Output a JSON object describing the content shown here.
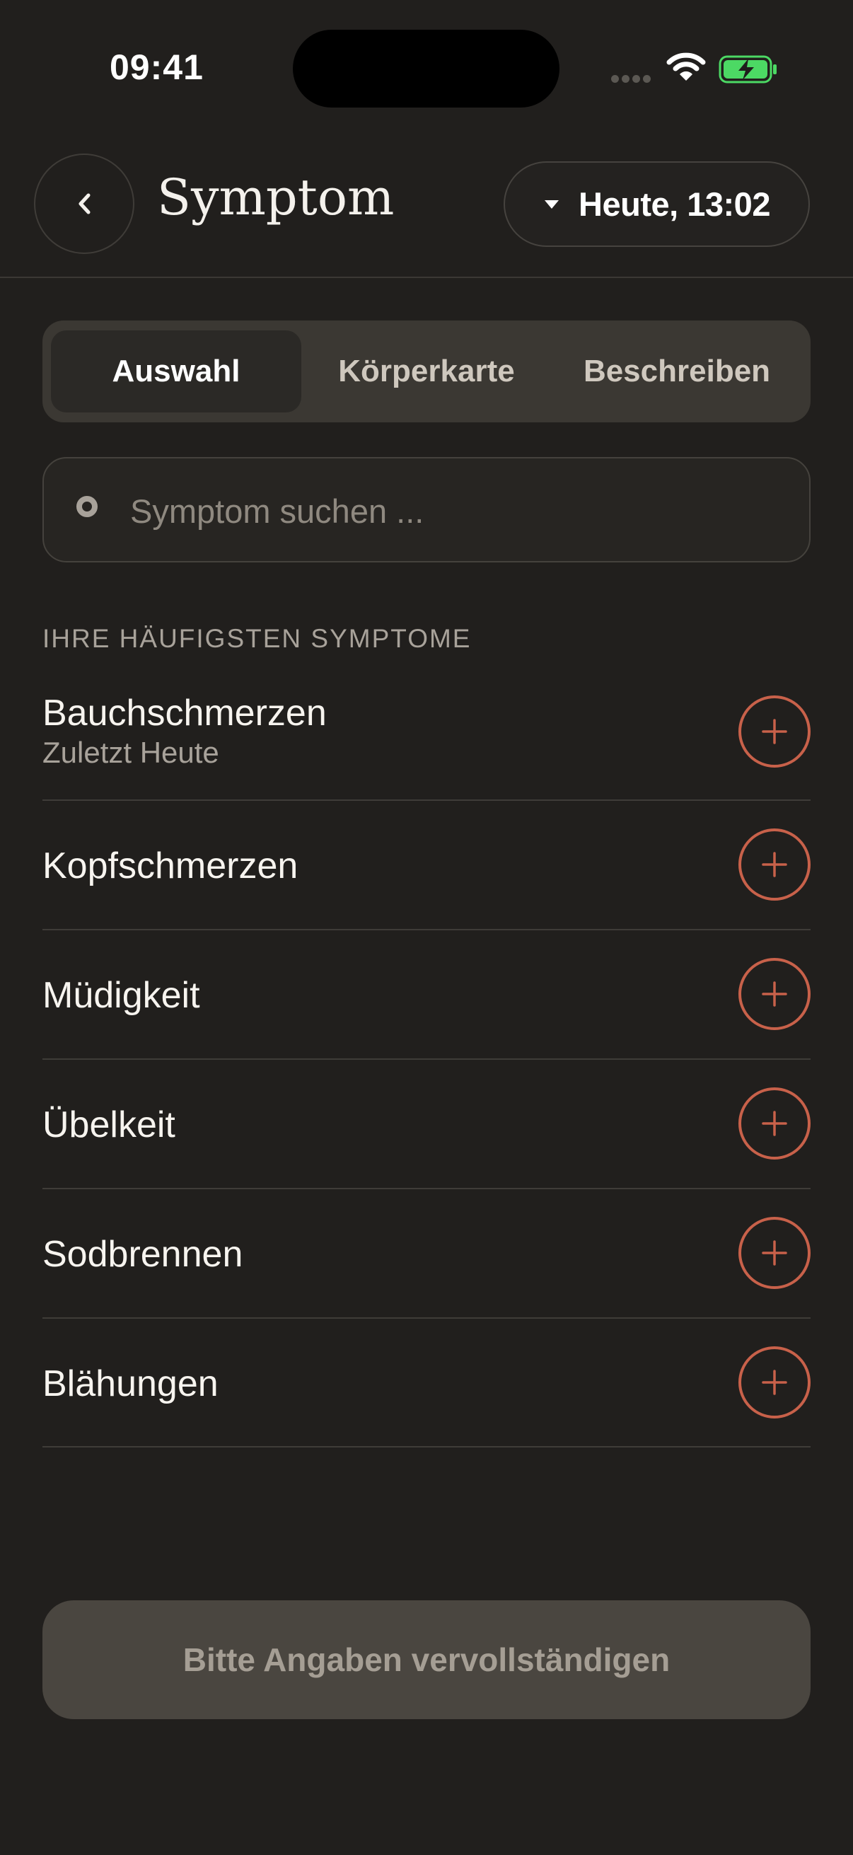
{
  "status_bar": {
    "time": "09:41",
    "icons": [
      "cellular-signal-icon",
      "wifi-icon",
      "battery-charging-icon"
    ],
    "battery_color": "#4cd964"
  },
  "header": {
    "title": "Symptom",
    "date_button_label": "Heute, 13:02",
    "icons": [
      "chevron-left-icon",
      "caret-down-icon"
    ]
  },
  "tabs": [
    {
      "label": "Auswahl",
      "active": true
    },
    {
      "label": "Körperkarte",
      "active": false
    },
    {
      "label": "Beschreiben",
      "active": false
    }
  ],
  "search": {
    "placeholder": "Symptom suchen ...",
    "value": ""
  },
  "section": {
    "heading": "IHRE HÄUFIGSTEN SYMPTOME"
  },
  "symptoms": [
    {
      "name": "Bauchschmerzen",
      "subtitle": "Zuletzt Heute"
    },
    {
      "name": "Kopfschmerzen"
    },
    {
      "name": "Müdigkeit"
    },
    {
      "name": "Übelkeit"
    },
    {
      "name": "Sodbrennen"
    },
    {
      "name": "Blähungen"
    }
  ],
  "footer": {
    "submit_label": "Bitte Angaben vervollständigen"
  },
  "colors": {
    "background": "#211f1d",
    "accent": "#c8614a",
    "text": "#f4f1ec",
    "muted_text": "#a8a29a",
    "disabled_button": "#4a4640"
  }
}
